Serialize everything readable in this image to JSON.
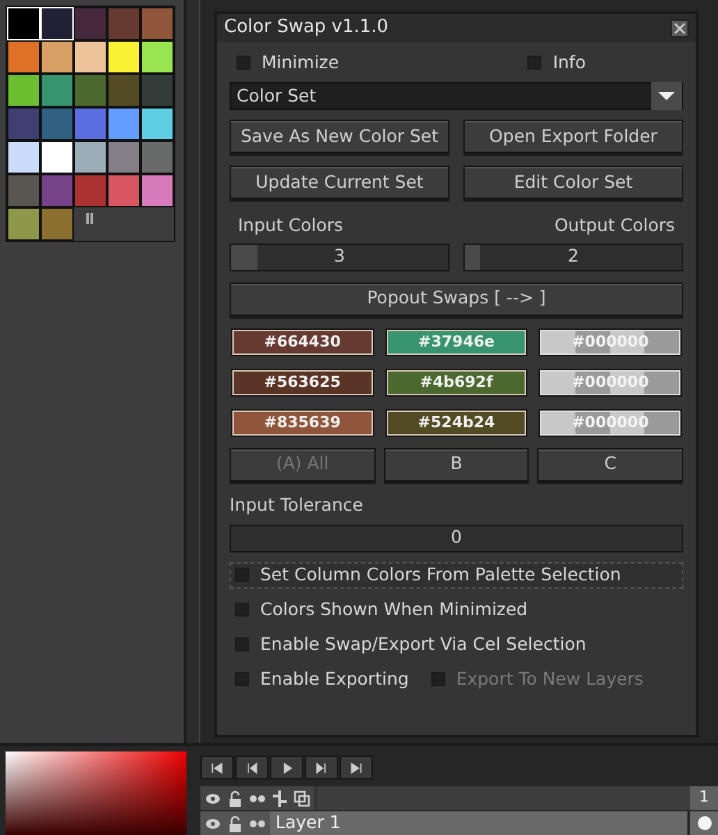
{
  "palette": {
    "colors": [
      {
        "color": "#000000",
        "selected": true
      },
      {
        "color": "#222034",
        "selected": true
      },
      {
        "color": "#45283c",
        "selected": false
      },
      {
        "color": "#663931",
        "selected": false
      },
      {
        "color": "#8f563b",
        "selected": false
      },
      {
        "color": "#df7126",
        "selected": false
      },
      {
        "color": "#d9a066",
        "selected": false
      },
      {
        "color": "#eec39a",
        "selected": false
      },
      {
        "color": "#fbf236",
        "selected": false
      },
      {
        "color": "#99e550",
        "selected": false
      },
      {
        "color": "#6abe30",
        "selected": false
      },
      {
        "color": "#37946e",
        "selected": false
      },
      {
        "color": "#4b692f",
        "selected": false
      },
      {
        "color": "#524b24",
        "selected": false
      },
      {
        "color": "#323c39",
        "selected": false
      },
      {
        "color": "#3f3f74",
        "selected": false
      },
      {
        "color": "#306082",
        "selected": false
      },
      {
        "color": "#5b6ee1",
        "selected": false
      },
      {
        "color": "#639bff",
        "selected": false
      },
      {
        "color": "#5fcde4",
        "selected": false
      },
      {
        "color": "#cbdbfc",
        "selected": false
      },
      {
        "color": "#ffffff",
        "selected": false
      },
      {
        "color": "#9badb7",
        "selected": false
      },
      {
        "color": "#847e87",
        "selected": false
      },
      {
        "color": "#696a6a",
        "selected": false
      },
      {
        "color": "#595652",
        "selected": false
      },
      {
        "color": "#76428a",
        "selected": false
      },
      {
        "color": "#ac3232",
        "selected": false
      },
      {
        "color": "#d95763",
        "selected": false
      },
      {
        "color": "#d77bba",
        "selected": false
      },
      {
        "color": "#8f974a",
        "selected": false
      },
      {
        "color": "#8a6f30",
        "selected": false
      }
    ]
  },
  "dialog": {
    "title": "Color Swap v1.1.0",
    "top_checks": [
      {
        "label": "Minimize",
        "checked": false
      },
      {
        "label": "Info",
        "checked": false
      }
    ],
    "color_set": {
      "value": "Color Set"
    },
    "buttons": [
      {
        "label": "Save As New Color Set"
      },
      {
        "label": "Open Export Folder"
      },
      {
        "label": "Update Current Set"
      },
      {
        "label": "Edit Color Set"
      }
    ],
    "input_colors": {
      "label": "Input Colors",
      "value": "3",
      "level": 0.12
    },
    "output_colors": {
      "label": "Output Colors",
      "value": "2",
      "level": 0.07
    },
    "popout": "Popout Swaps [ --> ]",
    "swatches": [
      [
        {
          "kind": "color",
          "label": "#664430",
          "color": "#663931"
        },
        {
          "kind": "color",
          "label": "#37946e",
          "color": "#37946e"
        },
        {
          "kind": "transparent",
          "label": "#000000"
        }
      ],
      [
        {
          "kind": "color",
          "label": "#563625",
          "color": "#5a3526"
        },
        {
          "kind": "color",
          "label": "#4b692f",
          "color": "#4b692f"
        },
        {
          "kind": "transparent",
          "label": "#000000"
        }
      ],
      [
        {
          "kind": "color",
          "label": "#835639",
          "color": "#8f563b"
        },
        {
          "kind": "color",
          "label": "#524b24",
          "color": "#524b24"
        },
        {
          "kind": "transparent",
          "label": "#000000"
        }
      ]
    ],
    "column_buttons": [
      {
        "label": "(A) All",
        "disabled": true
      },
      {
        "label": "B",
        "disabled": false
      },
      {
        "label": "C",
        "disabled": false
      }
    ],
    "tolerance": {
      "label": "Input Tolerance",
      "value": "0"
    },
    "options": [
      {
        "label": "Set Column Colors From Palette Selection",
        "checked": false,
        "focused": true
      },
      {
        "label": "Colors Shown When Minimized",
        "checked": false
      },
      {
        "label": "Enable Swap/Export Via Cel Selection",
        "checked": false
      }
    ],
    "export_checks": [
      {
        "label": "Enable Exporting",
        "checked": false,
        "disabled": false
      },
      {
        "label": "Export To New Layers",
        "checked": false,
        "disabled": true
      }
    ]
  },
  "timeline": {
    "frame_header": "1",
    "layers": [
      {
        "name": "Layer 1"
      }
    ]
  }
}
